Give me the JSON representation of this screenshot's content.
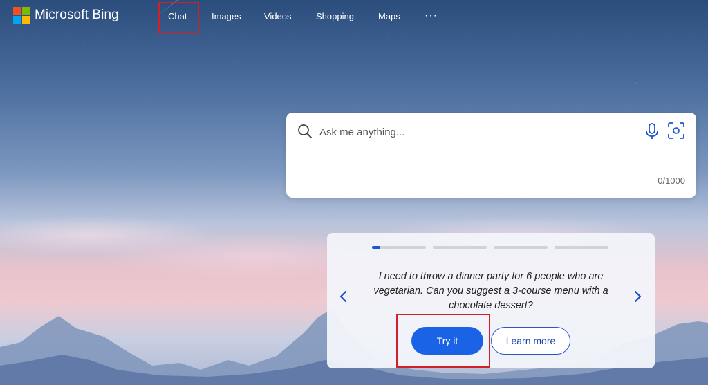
{
  "brand": {
    "name": "Microsoft Bing",
    "logo_colors": [
      "#f25022",
      "#7fba00",
      "#00a4ef",
      "#ffb900"
    ]
  },
  "nav": {
    "items": [
      {
        "label": "Chat",
        "highlighted": true
      },
      {
        "label": "Images"
      },
      {
        "label": "Videos"
      },
      {
        "label": "Shopping"
      },
      {
        "label": "Maps"
      }
    ],
    "more_label": "···"
  },
  "search": {
    "placeholder": "Ask me anything...",
    "value": "",
    "char_count": "0/1000",
    "icons": [
      "search-icon",
      "microphone-icon",
      "visual-search-icon"
    ]
  },
  "suggestion": {
    "text": "I need to throw a dinner party for 6 people who are vegetarian. Can you suggest a 3-course menu with a chocolate dessert?",
    "slide_count": 4,
    "active_slide_progress": 0.15,
    "try_label": "Try it",
    "learn_label": "Learn more",
    "try_highlighted": true
  },
  "colors": {
    "accent": "#1a63e6",
    "highlight_box": "#d0202a",
    "link": "#1a3fae"
  }
}
